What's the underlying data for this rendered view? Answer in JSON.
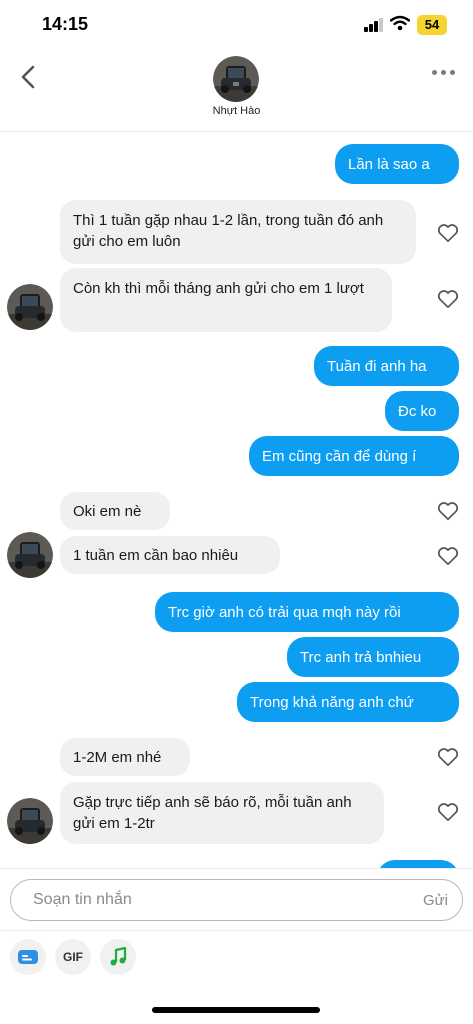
{
  "status_bar": {
    "time": "14:15",
    "battery": "54"
  },
  "header": {
    "contact_name": "Nhựt Hào"
  },
  "messages": [
    {
      "text": "Lần là sao a"
    },
    {
      "text": "Thì 1 tuần gặp nhau 1-2 lần, trong tuần đó anh gửi cho em luôn"
    },
    {
      "text": "Còn kh thì mỗi tháng anh gửi cho em 1 lượt"
    },
    {
      "text": "Tuần đi anh ha"
    },
    {
      "text": "Đc ko"
    },
    {
      "text": "Em cũng cần để dùng í"
    },
    {
      "text": "Oki em nè"
    },
    {
      "text": "1 tuần em cần bao nhiêu"
    },
    {
      "text": "Trc giờ anh có trải qua mqh này rồi"
    },
    {
      "text": "Trc anh trả bnhieu"
    },
    {
      "text": "Trong khả năng anh chứ"
    },
    {
      "text": "1-2M em nhé"
    },
    {
      "text": "Gặp trực tiếp anh sẽ báo rõ, mỗi tuần anh gửi em 1-2tr"
    }
  ],
  "composer": {
    "placeholder": "Soạn tin nhắn",
    "send_label": "Gửi"
  },
  "toolbar": {
    "gif_label": "GIF"
  },
  "colors": {
    "outgoing_bubble": "#0d9ef2",
    "incoming_bubble": "#f0f0f0",
    "battery": "#f4d42f"
  },
  "icons": [
    "back-icon",
    "more-icon",
    "heart-icon",
    "sticker-icon",
    "gif-icon",
    "music-icon",
    "signal-icon",
    "wifi-icon"
  ]
}
